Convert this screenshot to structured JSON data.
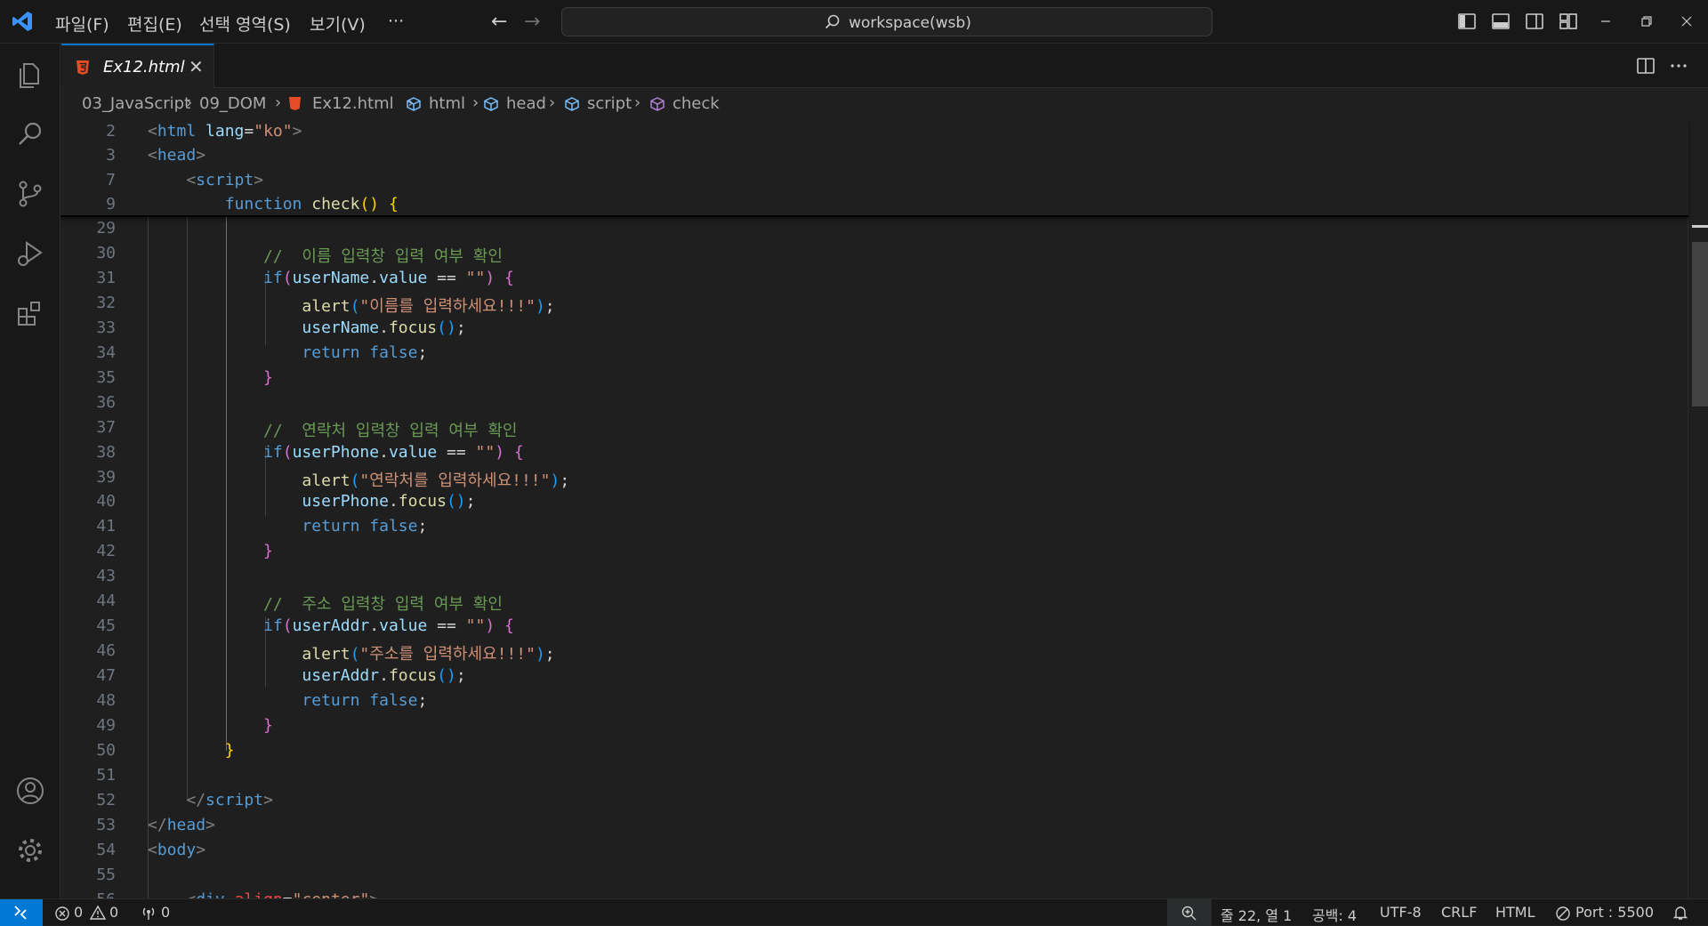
{
  "titlebar": {
    "menu": [
      "파일(F)",
      "편집(E)",
      "선택 영역(S)",
      "보기(V)",
      "···"
    ],
    "search": "workspace(wsb)"
  },
  "tab": {
    "name": "Ex12.html",
    "close": "✕"
  },
  "breadcrumb": [
    "03_JavaScript",
    "09_DOM",
    "Ex12.html",
    "html",
    "head",
    "script",
    "check"
  ],
  "sticky": [
    {
      "n": "2",
      "segs": [
        {
          "c": "p",
          "t": "<"
        },
        {
          "c": "t",
          "t": "html"
        },
        {
          "c": "w",
          "t": " "
        },
        {
          "c": "a",
          "t": "lang"
        },
        {
          "c": "w",
          "t": "="
        },
        {
          "c": "s",
          "t": "\"ko\""
        },
        {
          "c": "p",
          "t": ">"
        }
      ]
    },
    {
      "n": "3",
      "segs": [
        {
          "c": "p",
          "t": "<"
        },
        {
          "c": "t",
          "t": "head"
        },
        {
          "c": "p",
          "t": ">"
        }
      ]
    },
    {
      "n": "7",
      "segs": [
        {
          "c": "w",
          "t": "    "
        },
        {
          "c": "p",
          "t": "<"
        },
        {
          "c": "t",
          "t": "script"
        },
        {
          "c": "p",
          "t": ">"
        }
      ]
    },
    {
      "n": "9",
      "segs": [
        {
          "c": "w",
          "t": "        "
        },
        {
          "c": "k",
          "t": "function"
        },
        {
          "c": "w",
          "t": " "
        },
        {
          "c": "f",
          "t": "check"
        },
        {
          "c": "b1",
          "t": "()"
        },
        {
          "c": "w",
          "t": " "
        },
        {
          "c": "b1",
          "t": "{"
        }
      ]
    }
  ],
  "lines": [
    {
      "n": "29",
      "segs": []
    },
    {
      "n": "30",
      "segs": [
        {
          "c": "w",
          "t": "            "
        },
        {
          "c": "c",
          "t": "//  이름 입력창 입력 여부 확인"
        }
      ]
    },
    {
      "n": "31",
      "segs": [
        {
          "c": "w",
          "t": "            "
        },
        {
          "c": "k",
          "t": "if"
        },
        {
          "c": "b2",
          "t": "("
        },
        {
          "c": "v",
          "t": "userName"
        },
        {
          "c": "w",
          "t": "."
        },
        {
          "c": "v",
          "t": "value"
        },
        {
          "c": "w",
          "t": " == "
        },
        {
          "c": "s",
          "t": "\"\""
        },
        {
          "c": "b2",
          "t": ")"
        },
        {
          "c": "w",
          "t": " "
        },
        {
          "c": "b2",
          "t": "{"
        }
      ]
    },
    {
      "n": "32",
      "segs": [
        {
          "c": "w",
          "t": "                "
        },
        {
          "c": "f",
          "t": "alert"
        },
        {
          "c": "b3",
          "t": "("
        },
        {
          "c": "s",
          "t": "\"이름를 입력하세요!!!\""
        },
        {
          "c": "b3",
          "t": ")"
        },
        {
          "c": "w",
          "t": ";"
        }
      ]
    },
    {
      "n": "33",
      "segs": [
        {
          "c": "w",
          "t": "                "
        },
        {
          "c": "v",
          "t": "userName"
        },
        {
          "c": "w",
          "t": "."
        },
        {
          "c": "f",
          "t": "focus"
        },
        {
          "c": "b3",
          "t": "()"
        },
        {
          "c": "w",
          "t": ";"
        }
      ]
    },
    {
      "n": "34",
      "segs": [
        {
          "c": "w",
          "t": "                "
        },
        {
          "c": "k",
          "t": "return"
        },
        {
          "c": "w",
          "t": " "
        },
        {
          "c": "k",
          "t": "false"
        },
        {
          "c": "w",
          "t": ";"
        }
      ]
    },
    {
      "n": "35",
      "segs": [
        {
          "c": "w",
          "t": "            "
        },
        {
          "c": "b2",
          "t": "}"
        }
      ]
    },
    {
      "n": "36",
      "segs": []
    },
    {
      "n": "37",
      "segs": [
        {
          "c": "w",
          "t": "            "
        },
        {
          "c": "c",
          "t": "//  연락처 입력창 입력 여부 확인"
        }
      ]
    },
    {
      "n": "38",
      "segs": [
        {
          "c": "w",
          "t": "            "
        },
        {
          "c": "k",
          "t": "if"
        },
        {
          "c": "b2",
          "t": "("
        },
        {
          "c": "v",
          "t": "userPhone"
        },
        {
          "c": "w",
          "t": "."
        },
        {
          "c": "v",
          "t": "value"
        },
        {
          "c": "w",
          "t": " == "
        },
        {
          "c": "s",
          "t": "\"\""
        },
        {
          "c": "b2",
          "t": ")"
        },
        {
          "c": "w",
          "t": " "
        },
        {
          "c": "b2",
          "t": "{"
        }
      ]
    },
    {
      "n": "39",
      "segs": [
        {
          "c": "w",
          "t": "                "
        },
        {
          "c": "f",
          "t": "alert"
        },
        {
          "c": "b3",
          "t": "("
        },
        {
          "c": "s",
          "t": "\"연락처를 입력하세요!!!\""
        },
        {
          "c": "b3",
          "t": ")"
        },
        {
          "c": "w",
          "t": ";"
        }
      ]
    },
    {
      "n": "40",
      "segs": [
        {
          "c": "w",
          "t": "                "
        },
        {
          "c": "v",
          "t": "userPhone"
        },
        {
          "c": "w",
          "t": "."
        },
        {
          "c": "f",
          "t": "focus"
        },
        {
          "c": "b3",
          "t": "()"
        },
        {
          "c": "w",
          "t": ";"
        }
      ]
    },
    {
      "n": "41",
      "segs": [
        {
          "c": "w",
          "t": "                "
        },
        {
          "c": "k",
          "t": "return"
        },
        {
          "c": "w",
          "t": " "
        },
        {
          "c": "k",
          "t": "false"
        },
        {
          "c": "w",
          "t": ";"
        }
      ]
    },
    {
      "n": "42",
      "segs": [
        {
          "c": "w",
          "t": "            "
        },
        {
          "c": "b2",
          "t": "}"
        }
      ]
    },
    {
      "n": "43",
      "segs": []
    },
    {
      "n": "44",
      "segs": [
        {
          "c": "w",
          "t": "            "
        },
        {
          "c": "c",
          "t": "//  주소 입력창 입력 여부 확인"
        }
      ]
    },
    {
      "n": "45",
      "segs": [
        {
          "c": "w",
          "t": "            "
        },
        {
          "c": "k",
          "t": "if"
        },
        {
          "c": "b2",
          "t": "("
        },
        {
          "c": "v",
          "t": "userAddr"
        },
        {
          "c": "w",
          "t": "."
        },
        {
          "c": "v",
          "t": "value"
        },
        {
          "c": "w",
          "t": " == "
        },
        {
          "c": "s",
          "t": "\"\""
        },
        {
          "c": "b2",
          "t": ")"
        },
        {
          "c": "w",
          "t": " "
        },
        {
          "c": "b2",
          "t": "{"
        }
      ]
    },
    {
      "n": "46",
      "segs": [
        {
          "c": "w",
          "t": "                "
        },
        {
          "c": "f",
          "t": "alert"
        },
        {
          "c": "b3",
          "t": "("
        },
        {
          "c": "s",
          "t": "\"주소를 입력하세요!!!\""
        },
        {
          "c": "b3",
          "t": ")"
        },
        {
          "c": "w",
          "t": ";"
        }
      ]
    },
    {
      "n": "47",
      "segs": [
        {
          "c": "w",
          "t": "                "
        },
        {
          "c": "v",
          "t": "userAddr"
        },
        {
          "c": "w",
          "t": "."
        },
        {
          "c": "f",
          "t": "focus"
        },
        {
          "c": "b3",
          "t": "()"
        },
        {
          "c": "w",
          "t": ";"
        }
      ]
    },
    {
      "n": "48",
      "segs": [
        {
          "c": "w",
          "t": "                "
        },
        {
          "c": "k",
          "t": "return"
        },
        {
          "c": "w",
          "t": " "
        },
        {
          "c": "k",
          "t": "false"
        },
        {
          "c": "w",
          "t": ";"
        }
      ]
    },
    {
      "n": "49",
      "segs": [
        {
          "c": "w",
          "t": "            "
        },
        {
          "c": "b2",
          "t": "}"
        }
      ]
    },
    {
      "n": "50",
      "segs": [
        {
          "c": "w",
          "t": "        "
        },
        {
          "c": "b1",
          "t": "}"
        }
      ]
    },
    {
      "n": "51",
      "segs": []
    },
    {
      "n": "52",
      "segs": [
        {
          "c": "w",
          "t": "    "
        },
        {
          "c": "p",
          "t": "</"
        },
        {
          "c": "t",
          "t": "script"
        },
        {
          "c": "p",
          "t": ">"
        }
      ]
    },
    {
      "n": "53",
      "segs": [
        {
          "c": "p",
          "t": "</"
        },
        {
          "c": "t",
          "t": "head"
        },
        {
          "c": "p",
          "t": ">"
        }
      ]
    },
    {
      "n": "54",
      "segs": [
        {
          "c": "p",
          "t": "<"
        },
        {
          "c": "t",
          "t": "body"
        },
        {
          "c": "p",
          "t": ">"
        }
      ]
    },
    {
      "n": "55",
      "segs": []
    },
    {
      "n": "56",
      "segs": [
        {
          "c": "w",
          "t": "    "
        },
        {
          "c": "p",
          "t": "<"
        },
        {
          "c": "t",
          "t": "div"
        },
        {
          "c": "w",
          "t": " "
        },
        {
          "c": "ar",
          "t": "align"
        },
        {
          "c": "w",
          "t": "="
        },
        {
          "c": "s",
          "t": "\"center\""
        },
        {
          "c": "p",
          "t": ">"
        }
      ]
    }
  ],
  "status": {
    "errors": "0",
    "warnings": "0",
    "ports": "0",
    "position": "줄 22, 열 1",
    "spaces": "공백: 4",
    "encoding": "UTF-8",
    "eol": "CRLF",
    "language": "HTML",
    "port": "Port : 5500"
  }
}
